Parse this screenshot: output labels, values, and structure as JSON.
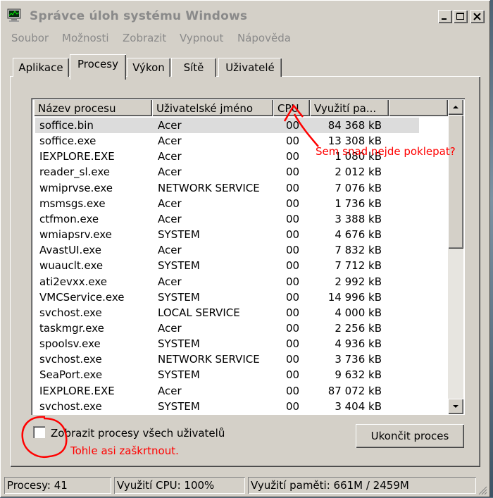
{
  "window": {
    "title": "Správce úloh systému Windows"
  },
  "menu": [
    "Soubor",
    "Možnosti",
    "Zobrazit",
    "Vypnout",
    "Nápověda"
  ],
  "tabs": [
    "Aplikace",
    "Procesy",
    "Výkon",
    "Sítě",
    "Uživatelé"
  ],
  "active_tab": "Procesy",
  "columns": [
    "Název procesu",
    "Uživatelské jméno",
    "CPU",
    "Využití pa..."
  ],
  "rows": [
    {
      "name": "soffice.bin",
      "user": "Acer",
      "cpu": "00",
      "mem": "84 368 kB"
    },
    {
      "name": "soffice.exe",
      "user": "Acer",
      "cpu": "00",
      "mem": "13 308 kB"
    },
    {
      "name": "IEXPLORE.EXE",
      "user": "Acer",
      "cpu": "00",
      "mem": "1 080 kB"
    },
    {
      "name": "reader_sl.exe",
      "user": "Acer",
      "cpu": "00",
      "mem": "2 012 kB"
    },
    {
      "name": "wmiprvse.exe",
      "user": "NETWORK SERVICE",
      "cpu": "00",
      "mem": "7 076 kB"
    },
    {
      "name": "msmsgs.exe",
      "user": "Acer",
      "cpu": "00",
      "mem": "1 736 kB"
    },
    {
      "name": "ctfmon.exe",
      "user": "Acer",
      "cpu": "00",
      "mem": "3 388 kB"
    },
    {
      "name": "wmiapsrv.exe",
      "user": "SYSTEM",
      "cpu": "00",
      "mem": "4 676 kB"
    },
    {
      "name": "AvastUI.exe",
      "user": "Acer",
      "cpu": "00",
      "mem": "7 832 kB"
    },
    {
      "name": "wuauclt.exe",
      "user": "SYSTEM",
      "cpu": "00",
      "mem": "7 712 kB"
    },
    {
      "name": "ati2evxx.exe",
      "user": "Acer",
      "cpu": "00",
      "mem": "2 992 kB"
    },
    {
      "name": "VMCService.exe",
      "user": "SYSTEM",
      "cpu": "00",
      "mem": "14 996 kB"
    },
    {
      "name": "svchost.exe",
      "user": "LOCAL SERVICE",
      "cpu": "00",
      "mem": "4 000 kB"
    },
    {
      "name": "taskmgr.exe",
      "user": "Acer",
      "cpu": "00",
      "mem": "2 256 kB"
    },
    {
      "name": "spoolsv.exe",
      "user": "SYSTEM",
      "cpu": "00",
      "mem": "4 936 kB"
    },
    {
      "name": "svchost.exe",
      "user": "NETWORK SERVICE",
      "cpu": "00",
      "mem": "3 736 kB"
    },
    {
      "name": "SeaPort.exe",
      "user": "SYSTEM",
      "cpu": "00",
      "mem": "9 632 kB"
    },
    {
      "name": "IEXPLORE.EXE",
      "user": "Acer",
      "cpu": "00",
      "mem": "87 072 kB"
    },
    {
      "name": "svchost.exe",
      "user": "SYSTEM",
      "cpu": "00",
      "mem": "3 404 kB"
    }
  ],
  "show_all_users": {
    "label": "Zobrazit procesy všech uživatelů",
    "checked": false
  },
  "end_process_label": "Ukončit proces",
  "status": {
    "processes": "Procesy: 41",
    "cpu": "Využití CPU: 100%",
    "memory": "Využití paměti: 661M / 2459M"
  },
  "annotations": {
    "note_cpu": "Sem snad nejde poklepat?",
    "note_checkbox": "Tohle asi zaškrtnout.",
    "color": "#ff0000"
  }
}
